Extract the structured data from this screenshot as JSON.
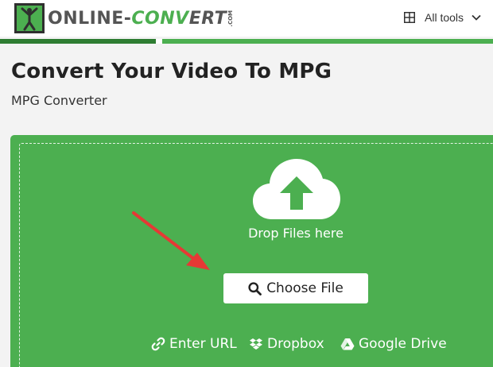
{
  "header": {
    "logo_text_a": "ONLINE-",
    "logo_text_b": "CONV",
    "logo_text_c": "ERT",
    "logo_com": ".COM",
    "all_tools_label": "All tools"
  },
  "page": {
    "title": "Convert Your Video To MPG",
    "subtitle": "MPG Converter"
  },
  "upload": {
    "drop_text": "Drop Files here",
    "choose_label": "Choose File",
    "sources": [
      {
        "label": "Enter URL",
        "icon": "link-icon"
      },
      {
        "label": "Dropbox",
        "icon": "dropbox-icon"
      },
      {
        "label": "Google Drive",
        "icon": "google-drive-icon"
      }
    ]
  },
  "colors": {
    "brand_green": "#4caf50",
    "dark_green": "#2e7d32",
    "annotation_red": "#e53935"
  }
}
